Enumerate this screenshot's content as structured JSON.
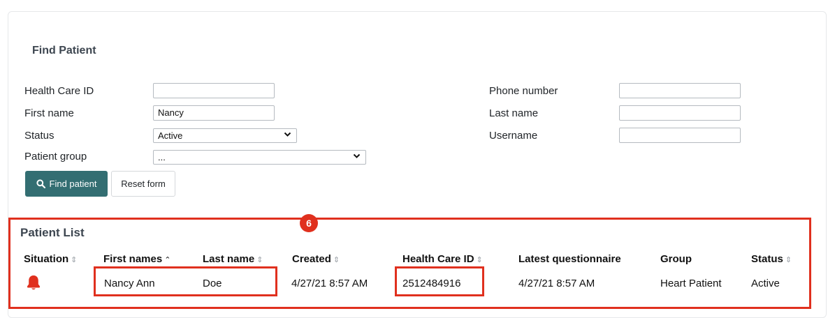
{
  "find_patient": {
    "title": "Find Patient",
    "fields": {
      "health_care_id": {
        "label": "Health Care ID",
        "value": ""
      },
      "first_name": {
        "label": "First name",
        "value": "Nancy"
      },
      "status": {
        "label": "Status",
        "value": "Active"
      },
      "patient_group": {
        "label": "Patient group",
        "value": "..."
      },
      "phone_number": {
        "label": "Phone number",
        "value": ""
      },
      "last_name": {
        "label": "Last name",
        "value": ""
      },
      "username": {
        "label": "Username",
        "value": ""
      }
    },
    "find_button_label": "Find patient",
    "reset_button_label": "Reset form"
  },
  "annotation": {
    "badge": "6",
    "color": "#e0301e"
  },
  "patient_list": {
    "title": "Patient List",
    "columns": [
      "Situation",
      "First names",
      "Last name",
      "Created",
      "Health Care ID",
      "Latest questionnaire",
      "Group",
      "Status"
    ],
    "sort_indicators": [
      "⇕",
      "⌃",
      "⇕",
      "⇕",
      "⇕",
      "",
      "",
      "⇕"
    ],
    "rows": [
      {
        "situation_icon": "bell-icon",
        "first_names": "Nancy Ann",
        "last_name": "Doe",
        "created": "4/27/21 8:57 AM",
        "health_care_id": "2512484916",
        "latest_questionnaire": "4/27/21 8:57 AM",
        "group": "Heart Patient",
        "status": "Active"
      }
    ]
  },
  "colors": {
    "primary_button": "#336e72",
    "alert_red": "#e0301e"
  }
}
